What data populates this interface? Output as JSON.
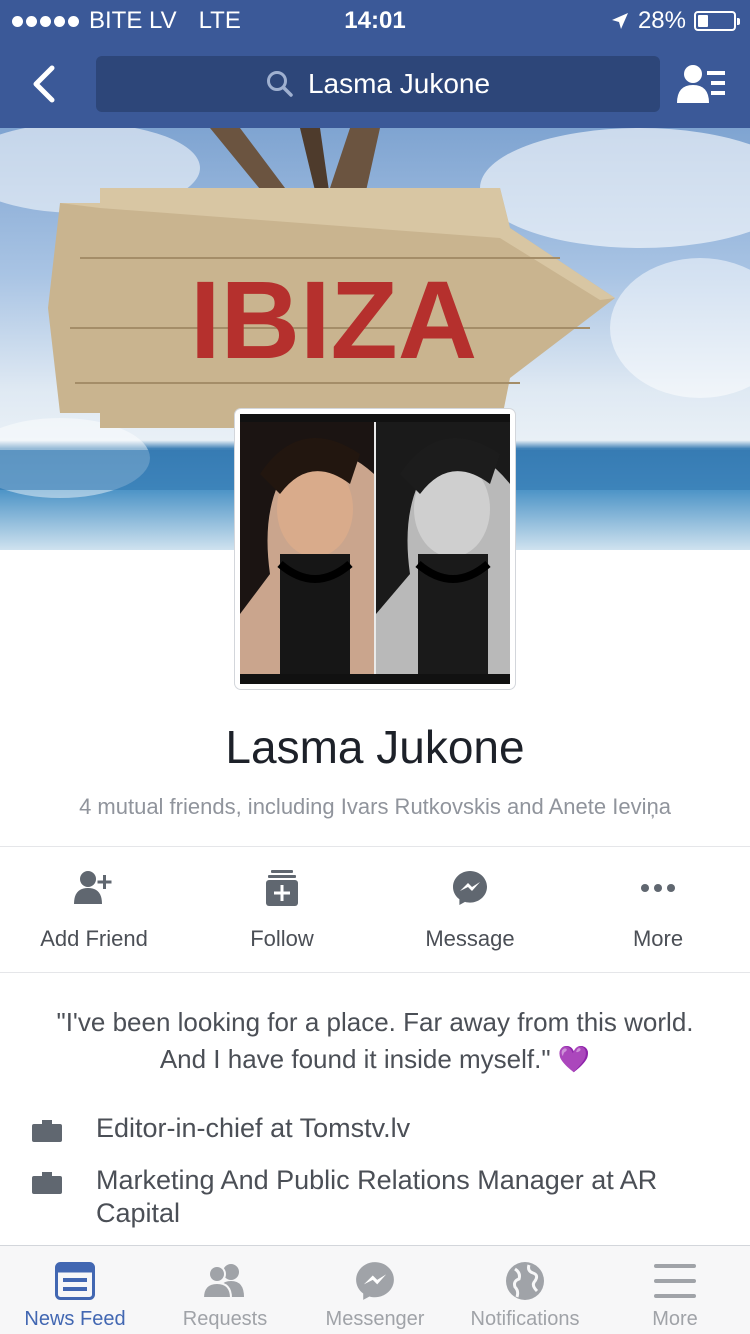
{
  "status_bar": {
    "carrier": "BITE LV",
    "network": "LTE",
    "time": "14:01",
    "battery_percent": "28%",
    "battery_level": 0.28
  },
  "nav_bar": {
    "search_text": "Lasma Jukone"
  },
  "cover": {
    "sign_text": "IBIZA"
  },
  "profile": {
    "name": "Lasma Jukone",
    "mutual_friends": "4 mutual friends, including Ivars Rutkovskis and Anete Ieviņa"
  },
  "actions": [
    {
      "label": "Add Friend",
      "icon": "add-friend-icon"
    },
    {
      "label": "Follow",
      "icon": "follow-icon"
    },
    {
      "label": "Message",
      "icon": "messenger-icon"
    },
    {
      "label": "More",
      "icon": "more-dots-icon"
    }
  ],
  "intro": {
    "bio": "\"I've been looking for a place. Far away from this world. And I have found it inside myself.\" 💜",
    "work": [
      "Editor-in-chief at Tomstv.lv",
      "Marketing And Public Relations Manager at AR Capital"
    ]
  },
  "tab_bar": {
    "tabs": [
      {
        "label": "News Feed",
        "icon": "news-feed-icon",
        "active": true
      },
      {
        "label": "Requests",
        "icon": "requests-icon",
        "active": false
      },
      {
        "label": "Messenger",
        "icon": "messenger-icon",
        "active": false
      },
      {
        "label": "Notifications",
        "icon": "globe-icon",
        "active": false
      },
      {
        "label": "More",
        "icon": "hamburger-menu-icon",
        "active": false
      }
    ]
  },
  "colors": {
    "brand": "#3b5998",
    "active_tab": "#4267b2",
    "sign_lettering": "#b5302d"
  }
}
